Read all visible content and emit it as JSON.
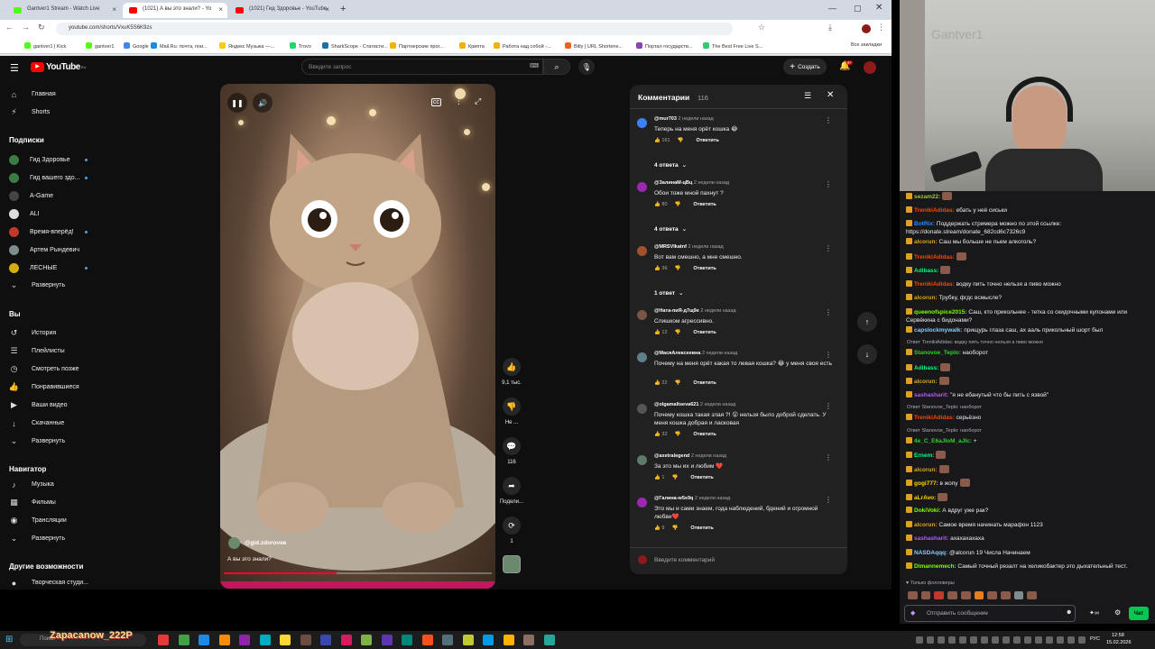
{
  "browser": {
    "tabs": [
      {
        "title": "Gantver1 Stream - Watch Live",
        "color": "#53fc18"
      },
      {
        "title": "(1021) А вы это знали? - Yo",
        "color": "#ff0000"
      },
      {
        "title": "(1021) Гид Здоровье - YouTube",
        "color": "#ff0000"
      }
    ],
    "new_tab": "+",
    "url": "youtube.com/shorts/VxuK5S6K9zs",
    "bookmarks": [
      {
        "label": "gantver1 | Kick",
        "color": "#53fc18"
      },
      {
        "label": "gantver1",
        "color": "#53fc18"
      },
      {
        "label": "Google",
        "color": "#4285f4"
      },
      {
        "label": "Mail.Ru: почта, пои...",
        "color": "#168de2"
      },
      {
        "label": "Яндекс Музыка —...",
        "color": "#ffcc00"
      },
      {
        "label": "Trovo",
        "color": "#1bd96a"
      },
      {
        "label": "SharkScope - Статисти...",
        "color": "#1d6fa5"
      },
      {
        "label": "Партнерские прог...",
        "color": "#f0b400"
      },
      {
        "label": "Крипта",
        "color": "#f0b400"
      },
      {
        "label": "Работа над собой -...",
        "color": "#f0b400"
      },
      {
        "label": "Bitly | URL Shortene...",
        "color": "#ee6123"
      },
      {
        "label": "Портал государств...",
        "color": "#8e44ad"
      },
      {
        "label": "The Best Free Live S...",
        "color": "#2ecc71"
      }
    ],
    "all_bookmarks": "Все закладки"
  },
  "youtube": {
    "logo": "YouTube",
    "logo_sup": "RU",
    "search_placeholder": "Введите запрос",
    "create_label": "Создать",
    "notif_count": "9+",
    "sidebar": {
      "main": [
        {
          "label": "Главная",
          "icon": "home-icon",
          "glyph": "⌂"
        },
        {
          "label": "Shorts",
          "icon": "shorts-icon",
          "glyph": "⚡"
        }
      ],
      "subs_title": "Подписки",
      "subscriptions": [
        {
          "label": "Гид Здоровье",
          "color": "#3a7d44",
          "dot": true
        },
        {
          "label": "Гид вашего здо...",
          "color": "#3a7d44",
          "dot": true
        },
        {
          "label": "A-Game",
          "color": "#444"
        },
        {
          "label": "ALI",
          "color": "#ddd"
        },
        {
          "label": "Время-вперёд!",
          "color": "#c0392b",
          "dot": true
        },
        {
          "label": "Артем Рындевич",
          "color": "#7f8c8d"
        },
        {
          "label": "ЛЕСНЫЕ",
          "color": "#d4ac0d",
          "dot": true
        }
      ],
      "expand": "Развернуть",
      "you_title": "Вы",
      "you": [
        {
          "label": "История",
          "glyph": "↺",
          "icon": "history-icon"
        },
        {
          "label": "Плейлисты",
          "glyph": "☰",
          "icon": "playlists-icon"
        },
        {
          "label": "Смотреть позже",
          "glyph": "◷",
          "icon": "watch-later-icon"
        },
        {
          "label": "Понравившиеся",
          "glyph": "👍",
          "icon": "liked-icon"
        },
        {
          "label": "Ваши видео",
          "glyph": "▶",
          "icon": "your-videos-icon"
        },
        {
          "label": "Скачанные",
          "glyph": "↓",
          "icon": "downloads-icon"
        },
        {
          "label": "Развернуть",
          "glyph": "⌄",
          "icon": "chevron-down-icon"
        }
      ],
      "nav_title": "Навигатор",
      "navigator": [
        {
          "label": "Музыка",
          "glyph": "♪",
          "icon": "music-icon"
        },
        {
          "label": "Фильмы",
          "glyph": "▦",
          "icon": "movies-icon"
        },
        {
          "label": "Трансляции",
          "glyph": "◉",
          "icon": "live-icon"
        },
        {
          "label": "Развернуть",
          "glyph": "⌄",
          "icon": "chevron-down-icon"
        }
      ],
      "other_title": "Другие возможности",
      "other": [
        {
          "label": "Творческая студи...",
          "glyph": "●",
          "icon": "studio-icon"
        }
      ]
    },
    "short": {
      "channel": "@gid.zdorovee",
      "title": "А вы это знали?",
      "progress": 0.42,
      "likes": "9,1 тыс.",
      "dislike_label": "Не ...",
      "comments_count": "116",
      "share_label": "Подели...",
      "remix_count": "1"
    },
    "comments_panel": {
      "title": "Комментарии",
      "count": "116",
      "reply_label": "Ответить",
      "input_placeholder": "Введите комментарий",
      "items": [
        {
          "author": "@mur703",
          "time": "2 недели назад",
          "text": "Теперь на меня орёт кошка 😂",
          "likes": "161",
          "color": "#3b82f6",
          "replies": "4 ответа"
        },
        {
          "author": "@ЗалинаМ-цВц",
          "time": "2 недели назад",
          "text": "Обои тоже мной пахнут ?",
          "likes": "80",
          "color": "#9c27b0",
          "replies": "4 ответа"
        },
        {
          "author": "@MRSVIkatnf",
          "time": "2 недели назад",
          "text": "Вот вам смешно, а мне смешно.",
          "likes": "36",
          "color": "#a0522d",
          "replies": "1 ответ"
        },
        {
          "author": "@Ната-пиЯ-д7щ9е",
          "time": "2 недели назад",
          "text": "Слишком агрессивно.",
          "likes": "12",
          "color": "#795548",
          "replies": ""
        },
        {
          "author": "@МасяАлексеевна",
          "time": "2 недели назад",
          "text": "Почему на меня орёт какая то левая кошка? 😂 у меня своя есть",
          "likes": "22",
          "color": "#607d8b",
          "replies": ""
        },
        {
          "author": "@olgamaltseva621",
          "time": "2 недели назад",
          "text": "Почему кошка такая злая ?! 😮 нельзя было доброй сделать. У меня кошка добрая и ласковая",
          "likes": "32",
          "color": "#555",
          "replies": ""
        },
        {
          "author": "@axetralegend",
          "time": "2 недели назад",
          "text": "За это мы их и любим ❤️",
          "likes": "1",
          "color": "#5d7a6a",
          "replies": ""
        },
        {
          "author": "@Галина-w5s9q",
          "time": "2 недели назад",
          "text": "Это мы и сами знаем, года наблюдений, бдений и огромной любви❤️",
          "likes": "9",
          "color": "#9c27b0",
          "replies": ""
        }
      ]
    }
  },
  "chat": {
    "messages": [
      {
        "user": "sezam22:",
        "color": "#9acd32",
        "text": "",
        "emote": true
      },
      {
        "user": "TrenikiAdidas:",
        "color": "#ff4500",
        "text": " ебать у неё сиськи"
      },
      {
        "user": "BotRix:",
        "color": "#1e90ff",
        "text": " Поддержать стримера можно по этой ссылке: https://donate.stream/donate_682cd6c7326c9"
      },
      {
        "user": "alcorun:",
        "color": "#daa520",
        "text": " Саш мы больше не пьем алкоголь?"
      },
      {
        "user": "TrenikiAdidas:",
        "color": "#ff4500",
        "text": "",
        "emote": true
      },
      {
        "user": "Adibass:",
        "color": "#00ff7f",
        "text": "",
        "emote": true
      },
      {
        "user": "TrenikiAdidas:",
        "color": "#ff4500",
        "text": " водку пить точно нельзя а пиво можно"
      },
      {
        "user": "alcorun:",
        "color": "#daa520",
        "text": " Трубку, фгдс всмысле?"
      },
      {
        "user": "queenofspice2015:",
        "color": "#7fff00",
        "text": " Саш, кто прикольнее - тетка со скидочными купонами или Сервёкина с бидонами?"
      },
      {
        "user": "capslockmywalk:",
        "color": "#87cefa",
        "text": " прищурь глаза саш, ах ааль прикольный шорт был"
      },
      {
        "reply": "Ответ TrenikiAdidas: водку пить точно нельзя а пиво можно"
      },
      {
        "user": "Stanovoe_Teplo:",
        "color": "#32cd32",
        "text": " наоборот"
      },
      {
        "user": "Adibass:",
        "color": "#00ff7f",
        "text": "",
        "emote": true
      },
      {
        "user": "alcorun:",
        "color": "#daa520",
        "text": "",
        "emote": true
      },
      {
        "user": "sashasharit:",
        "color": "#b05cff",
        "text": " \"я не ебанутый что бы пить с язвой\""
      },
      {
        "reply": "Ответ Stanovoe_Teplo: наоборот"
      },
      {
        "user": "TrenikiAdidas:",
        "color": "#ff4500",
        "text": " серьёзно"
      },
      {
        "reply": "Ответ Stanovoe_Teplo: наоборот"
      },
      {
        "user": "4e_C_E6aJIoM_aJIc:",
        "color": "#32cd32",
        "text": " +"
      },
      {
        "user": "Ernem:",
        "color": "#00ff7f",
        "text": "",
        "emote": true
      },
      {
        "user": "alcorun:",
        "color": "#daa520",
        "text": "",
        "emote": true
      },
      {
        "user": "gogi777:",
        "color": "#ffd700",
        "text": " в жопу",
        "emote": true
      },
      {
        "user": "aLrAvo:",
        "color": "#ffd700",
        "text": "",
        "emote": true
      },
      {
        "user": "DokiVoki:",
        "color": "#7fff00",
        "text": " А вдруг уже рак?"
      },
      {
        "user": "alcorun:",
        "color": "#daa520",
        "text": " Самое время начинать марафон 1123"
      },
      {
        "user": "sashasharit:",
        "color": "#b05cff",
        "text": " ахахахахаха"
      },
      {
        "user": "NASDAqqq:",
        "color": "#87cefa",
        "text": " @alcorun 19 Числа Начинаем"
      },
      {
        "user": "Dimannemech:",
        "color": "#7fff00",
        "text": " Самый точный резалт на хеликобактер это дыхательный тест."
      }
    ],
    "followers_only": "Только фолловеры",
    "input_placeholder": "Отправить сообщение",
    "send_label": "Чат"
  },
  "taskbar": {
    "start_label": "Поиск",
    "overlay_text": "Zapacanow_222P",
    "time": "12:58",
    "date": "15.02.2026",
    "lang": "РУС"
  }
}
